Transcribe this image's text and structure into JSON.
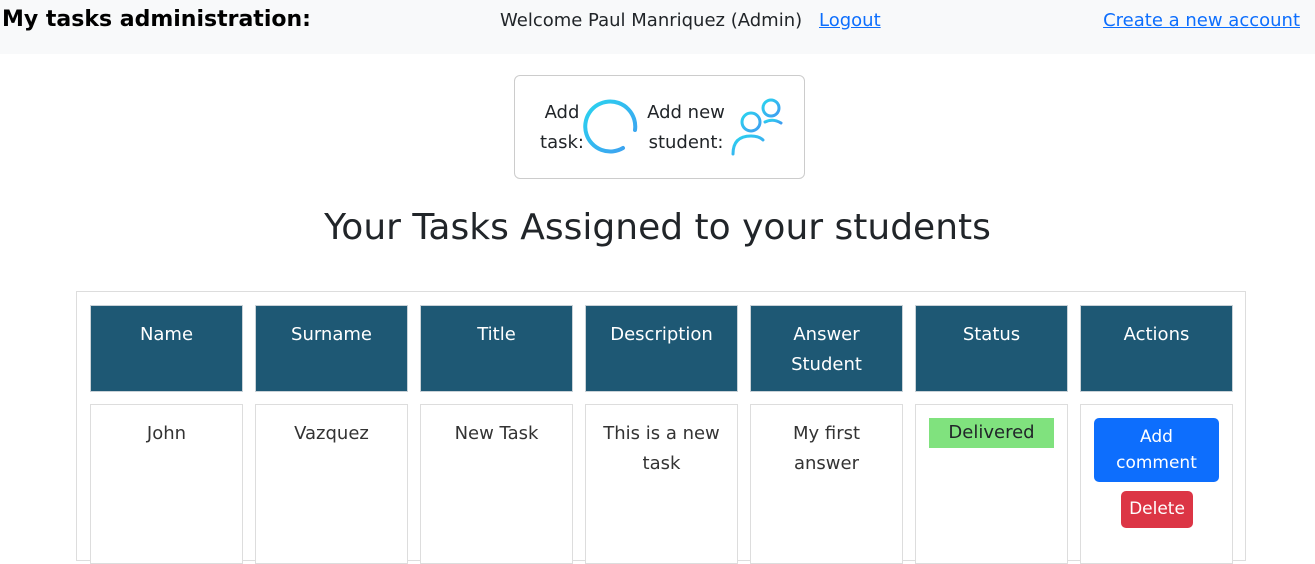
{
  "navbar": {
    "brand": "My tasks administration:",
    "welcome": "Welcome Paul Manriquez (Admin)",
    "logout": "Logout",
    "create_account": "Create a new account"
  },
  "actions_box": {
    "add_task_line1": "Add",
    "add_task_line2": "task:",
    "add_task_icon": "plus-circle-icon",
    "add_student_line1": "Add new",
    "add_student_line2": "student:",
    "add_student_icon": "add-users-icon"
  },
  "heading": "Your Tasks Assigned to your students",
  "table": {
    "headers": {
      "name": "Name",
      "surname": "Surname",
      "title": "Title",
      "description": "Description",
      "answer_line1": "Answer",
      "answer_line2": "Student",
      "status": "Status",
      "actions": "Actions"
    },
    "rows": [
      {
        "name": "John",
        "surname": "Vazquez",
        "title": "New Task",
        "description_line1": "This is a new",
        "description_line2": "task",
        "answer_line1": "My first",
        "answer_line2": "answer",
        "status": "Delivered",
        "add_comment_line1": "Add",
        "add_comment_line2": "comment",
        "delete": "Delete"
      }
    ]
  },
  "colors": {
    "header_bg": "#1e5874",
    "primary": "#0d6efd",
    "danger": "#dc3545",
    "delivered": "#80e27e",
    "icon_gradient_start": "#2ad4ef",
    "icon_gradient_end": "#3f9cf0"
  }
}
